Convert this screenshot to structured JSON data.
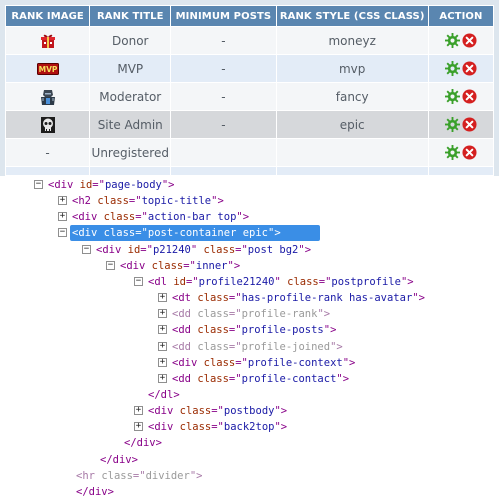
{
  "table": {
    "headers": [
      "RANK IMAGE",
      "RANK TITLE",
      "MINIMUM POSTS",
      "RANK STYLE (CSS CLASS)",
      "ACTION"
    ],
    "rows": [
      {
        "image": "red-gift-icon",
        "title": "Donor",
        "posts": "-",
        "style": "moneyz"
      },
      {
        "image": "mvp-badge-icon",
        "mvp_text": "MVP",
        "title": "MVP",
        "posts": "-",
        "style": "mvp"
      },
      {
        "image": "armored-knight-icon",
        "title": "Moderator",
        "posts": "-",
        "style": "fancy"
      },
      {
        "image": "skull-icon",
        "title": "Site Admin",
        "posts": "-",
        "style": "epic"
      },
      {
        "image_text": "-",
        "title": "Unregistered",
        "posts": "",
        "style": ""
      }
    ],
    "action_icons": [
      "gear-icon",
      "delete-icon"
    ],
    "colors": {
      "header": "#5a86b0",
      "row_light": "#f4f6f8",
      "row_blue": "#e3ecf7",
      "row_grey": "#d6d8db"
    }
  },
  "tree": {
    "nodes": [
      {
        "toggle": "−",
        "tag": "div",
        "attrs": [
          {
            "n": "id",
            "v": "page-body"
          }
        ]
      },
      {
        "toggle": "+",
        "tag": "h2",
        "attrs": [
          {
            "n": "class",
            "v": "topic-title"
          }
        ]
      },
      {
        "toggle": "+",
        "tag": "div",
        "attrs": [
          {
            "n": "class",
            "v": "action-bar top"
          }
        ]
      },
      {
        "toggle": "−",
        "tag": "div",
        "attrs": [
          {
            "n": "class",
            "v": "post-container epic"
          }
        ],
        "selected": true
      },
      {
        "toggle": "−",
        "tag": "div",
        "attrs": [
          {
            "n": "id",
            "v": "p21240"
          },
          {
            "n": "class",
            "v": "post bg2"
          }
        ]
      },
      {
        "toggle": "−",
        "tag": "div",
        "attrs": [
          {
            "n": "class",
            "v": "inner"
          }
        ]
      },
      {
        "toggle": "−",
        "tag": "dl",
        "attrs": [
          {
            "n": "id",
            "v": "profile21240"
          },
          {
            "n": "class",
            "v": "postprofile"
          }
        ]
      },
      {
        "toggle": "+",
        "tag": "dt",
        "attrs": [
          {
            "n": "class",
            "v": "has-profile-rank has-avatar"
          }
        ],
        "open_only": true
      },
      {
        "toggle": "+",
        "tag": "dd",
        "attrs": [
          {
            "n": "class",
            "v": "profile-rank"
          }
        ],
        "dim": true
      },
      {
        "toggle": "+",
        "tag": "dd",
        "attrs": [
          {
            "n": "class",
            "v": "profile-posts"
          }
        ]
      },
      {
        "toggle": "+",
        "tag": "dd",
        "attrs": [
          {
            "n": "class",
            "v": "profile-joined"
          }
        ],
        "dim": true
      },
      {
        "toggle": "+",
        "tag": "div",
        "attrs": [
          {
            "n": "class",
            "v": "profile-context"
          }
        ]
      },
      {
        "toggle": "+",
        "tag": "dd",
        "attrs": [
          {
            "n": "class",
            "v": "profile-contact"
          }
        ]
      },
      {
        "toggle": "",
        "close": "dl"
      },
      {
        "toggle": "+",
        "tag": "div",
        "attrs": [
          {
            "n": "class",
            "v": "postbody"
          }
        ]
      },
      {
        "toggle": "+",
        "tag": "div",
        "attrs": [
          {
            "n": "class",
            "v": "back2top"
          }
        ]
      },
      {
        "toggle": "",
        "close": "div"
      },
      {
        "toggle": "",
        "close": "div"
      },
      {
        "toggle": "",
        "tag": "hr",
        "attrs": [
          {
            "n": "class",
            "v": "divider"
          }
        ],
        "dim": true
      },
      {
        "toggle": "",
        "close": "div"
      }
    ]
  }
}
